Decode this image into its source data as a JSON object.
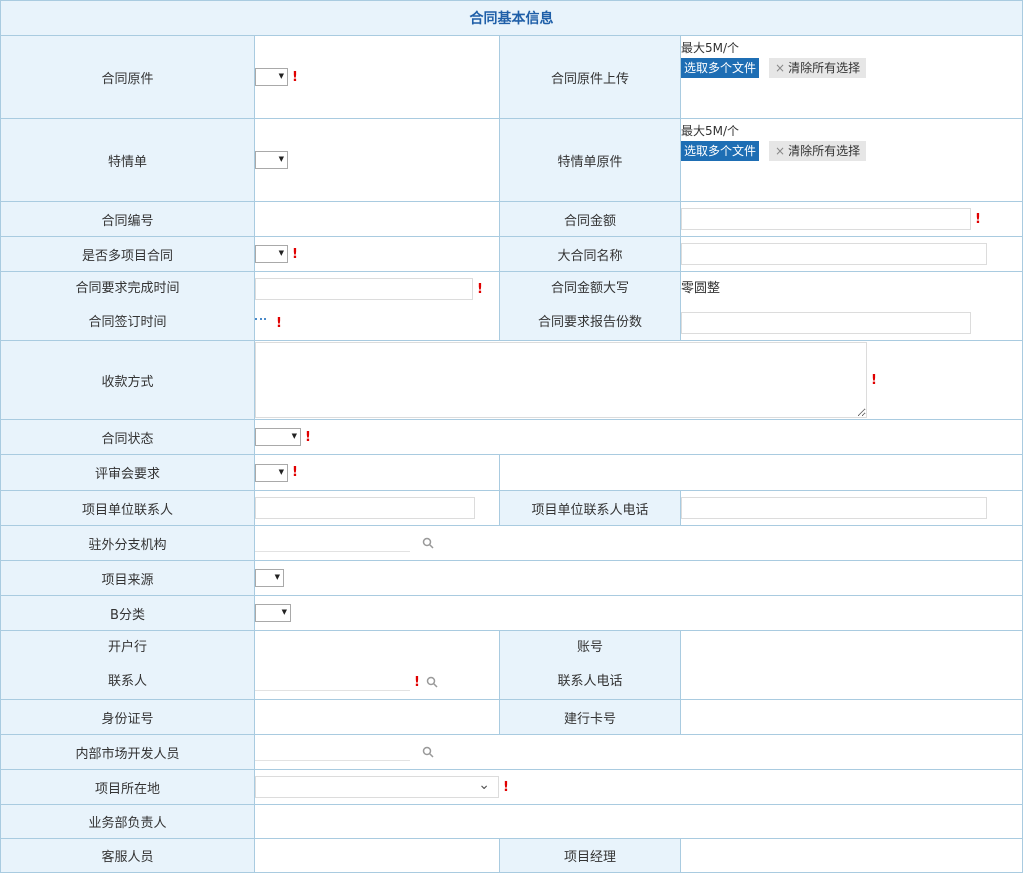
{
  "section_title": "合同基本信息",
  "req_mark": "!",
  "upload": {
    "limit": "最大5M/个",
    "pick_label": "选取多个文件",
    "clear_label": "清除所有选择",
    "clear_mark": "×"
  },
  "labels": {
    "contract_original": "合同原件",
    "contract_original_upload": "合同原件上传",
    "special_doc": "特情单",
    "special_doc_original": "特情单原件",
    "contract_no": "合同编号",
    "contract_amount": "合同金额",
    "is_multi_project": "是否多项目合同",
    "big_contract_name": "大合同名称",
    "required_finish_time": "合同要求完成时间",
    "amount_in_words": "合同金额大写",
    "sign_time": "合同签订时间",
    "report_copies": "合同要求报告份数",
    "payment_method": "收款方式",
    "contract_status": "合同状态",
    "review_required": "评审会要求",
    "project_contact": "项目单位联系人",
    "project_contact_phone": "项目单位联系人电话",
    "branch_org": "驻外分支机构",
    "project_source": "项目来源",
    "b_category": "B分类",
    "bank": "开户行",
    "account_no": "账号",
    "contact": "联系人",
    "contact_phone": "联系人电话",
    "id_no": "身份证号",
    "ccb_card": "建行卡号",
    "internal_dev": "内部市场开发人员",
    "project_location": "项目所在地",
    "biz_owner": "业务部负责人",
    "customer_service": "客服人员",
    "project_manager": "项目经理"
  },
  "values": {
    "amount_in_words": "零圆整"
  }
}
